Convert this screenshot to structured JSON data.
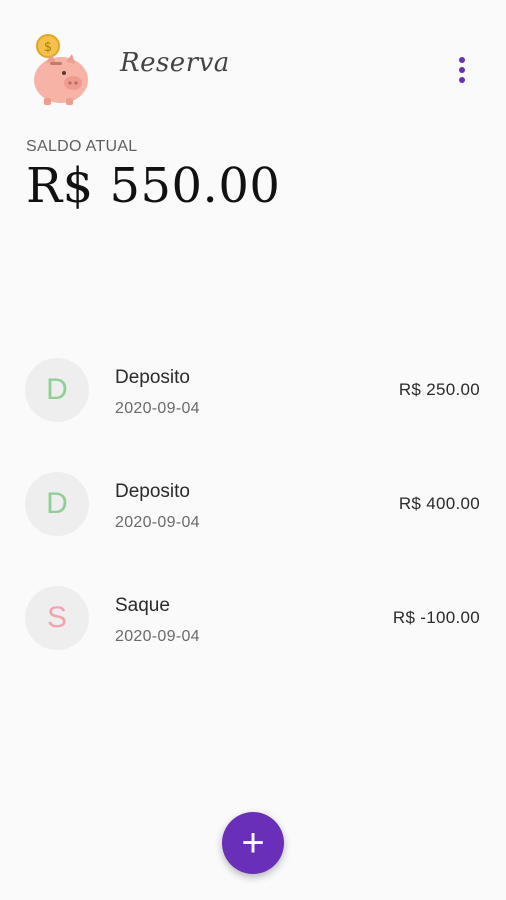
{
  "app": {
    "title": "Reserva",
    "logo_icon": "piggy-bank-with-coin",
    "menu_icon": "more-vert-icon",
    "accent": "#6a2fb8"
  },
  "balance": {
    "label": "SALDO ATUAL",
    "value": "R$ 550.00"
  },
  "transactions": [
    {
      "initial": "D",
      "title": "Deposito",
      "date": "2020-09-04",
      "amount": "R$ 250.00",
      "color": "#8fcf94"
    },
    {
      "initial": "D",
      "title": "Deposito",
      "date": "2020-09-04",
      "amount": "R$ 400.00",
      "color": "#8fcf94"
    },
    {
      "initial": "S",
      "title": "Saque",
      "date": "2020-09-04",
      "amount": "R$ -100.00",
      "color": "#f3a3ad"
    }
  ],
  "fab": {
    "label": "+",
    "icon": "add-icon"
  }
}
